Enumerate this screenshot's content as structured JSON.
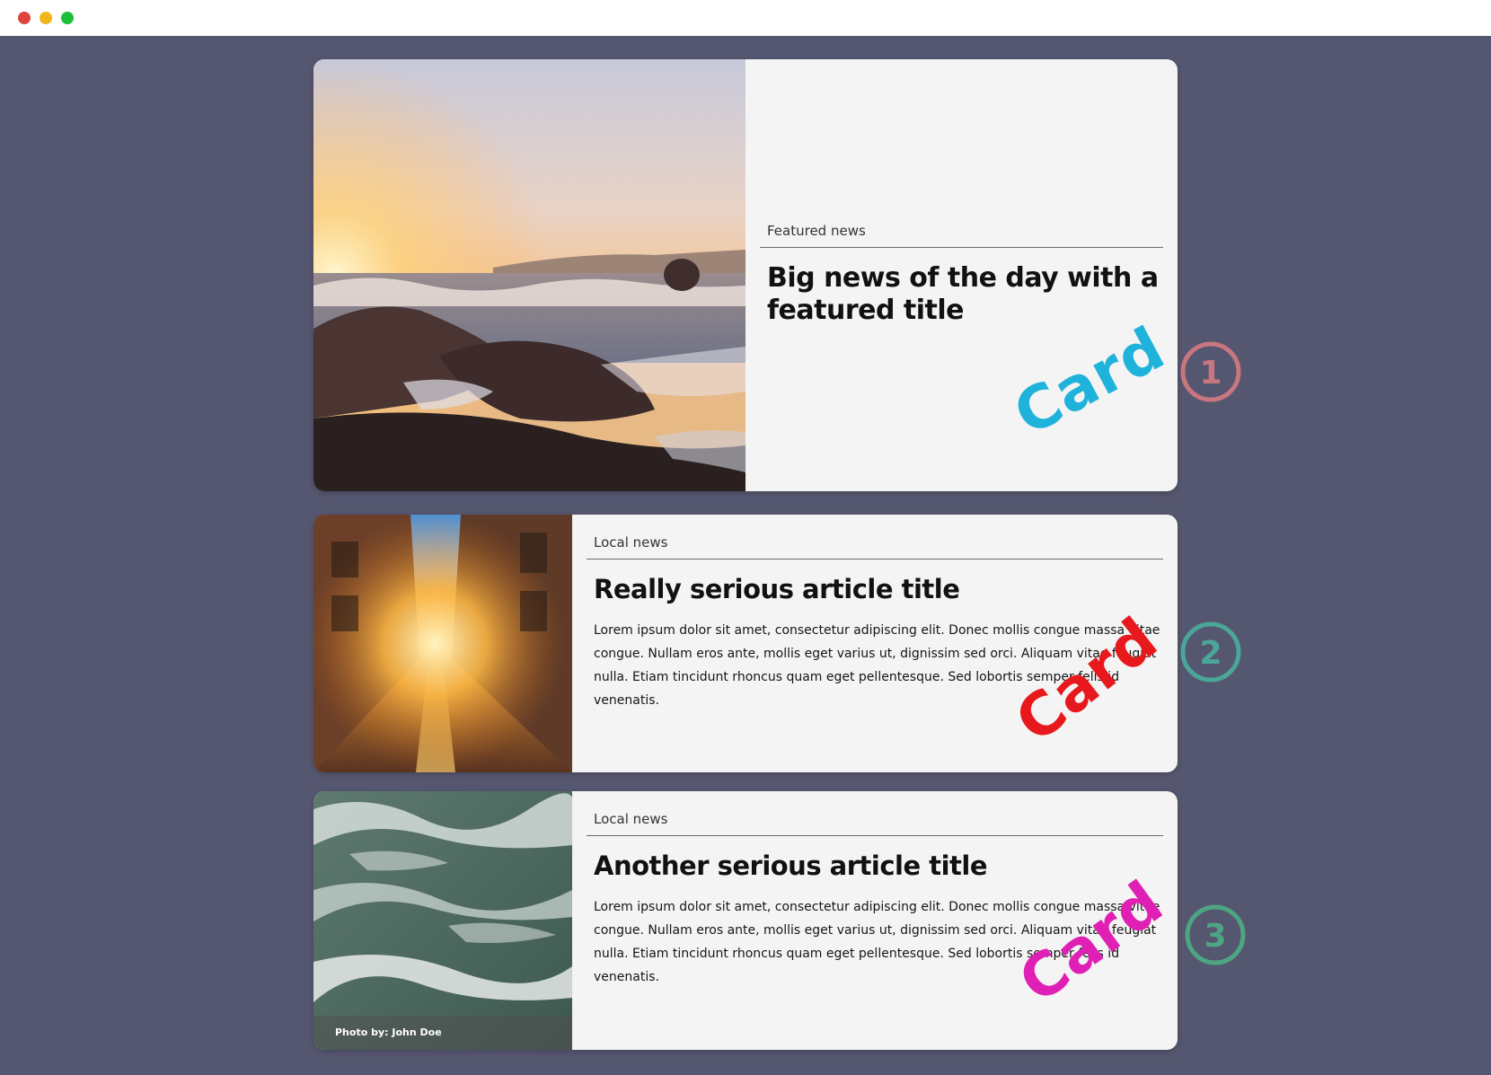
{
  "window": {
    "controls": [
      {
        "name": "close",
        "color": "#e0443e"
      },
      {
        "name": "minimize",
        "color": "#f2b61b"
      },
      {
        "name": "maximize",
        "color": "#1dbf3a"
      }
    ],
    "background": "#55566f"
  },
  "cards": [
    {
      "tag": "Featured news",
      "title": "Big news of the day with a featured title",
      "excerpt": "",
      "photo_credit": "",
      "image_subject": "sunset over rocky ocean shore"
    },
    {
      "tag": "Local news",
      "title": "Really serious article title",
      "excerpt": "Lorem ipsum dolor sit amet, consectetur adipiscing elit. Donec mollis congue massa vitae congue. Nullam eros ante, mollis eget varius ut, dignissim sed orci. Aliquam vitae feugiat nulla. Etiam tincidunt rhoncus quam eget pellentesque. Sed lobortis semper felis id venenatis.",
      "photo_credit": "",
      "image_subject": "sunlit city street between buildings"
    },
    {
      "tag": "Local news",
      "title": "Another serious article title",
      "excerpt": "Lorem ipsum dolor sit amet, consectetur adipiscing elit. Donec mollis congue massa vitae congue. Nullam eros ante, mollis eget varius ut, dignissim sed orci. Aliquam vitae feugiat nulla. Etiam tincidunt rhoncus quam eget pellentesque. Sed lobortis semper felis id venenatis.",
      "photo_credit": "Photo by: John Doe",
      "image_subject": "aerial view of foamy ocean waves"
    }
  ],
  "annotations": [
    {
      "label": "Card",
      "number": "1",
      "label_color": "#1fb3dc",
      "circle_color": "#c8767f"
    },
    {
      "label": "Card",
      "number": "2",
      "label_color": "#e8191d",
      "circle_color": "#4ba598"
    },
    {
      "label": "Card",
      "number": "3",
      "label_color": "#e01fb4",
      "circle_color": "#4da583"
    }
  ]
}
